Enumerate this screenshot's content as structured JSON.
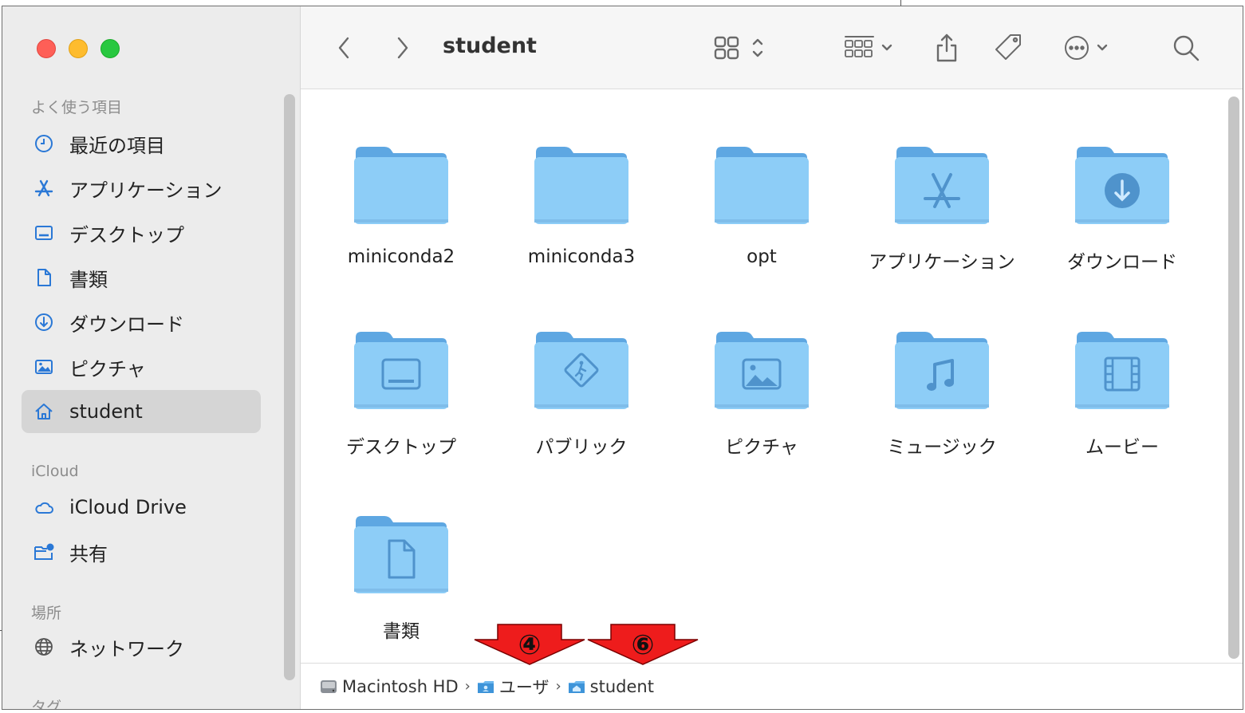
{
  "window": {
    "title": "student"
  },
  "toolbar": {
    "back_icon": "chevron-left-icon",
    "forward_icon": "chevron-right-icon",
    "title": "student",
    "view_icon": "icon-grid-view-icon",
    "group_icon": "group-view-icon",
    "share_icon": "share-icon",
    "tag_icon": "tag-icon",
    "more_icon": "ellipsis-circle-icon",
    "search_icon": "search-icon"
  },
  "sidebar": {
    "sections": {
      "favorites": "よく使う項目",
      "icloud": "iCloud",
      "locations": "場所",
      "tags": "タグ"
    },
    "favorites": [
      {
        "label": "最近の項目",
        "icon": "clock-icon"
      },
      {
        "label": "アプリケーション",
        "icon": "applications-icon"
      },
      {
        "label": "デスクトップ",
        "icon": "desktop-icon"
      },
      {
        "label": "書類",
        "icon": "document-icon"
      },
      {
        "label": "ダウンロード",
        "icon": "download-icon"
      },
      {
        "label": "ピクチャ",
        "icon": "photo-icon"
      },
      {
        "label": "student",
        "icon": "home-icon",
        "selected": true
      }
    ],
    "icloud": [
      {
        "label": "iCloud Drive",
        "icon": "cloud-icon"
      },
      {
        "label": "共有",
        "icon": "shared-folder-icon"
      }
    ],
    "locations": [
      {
        "label": "ネットワーク",
        "icon": "network-icon"
      }
    ]
  },
  "files": [
    {
      "label": "miniconda2",
      "glyph": "none"
    },
    {
      "label": "miniconda3",
      "glyph": "none"
    },
    {
      "label": "opt",
      "glyph": "none"
    },
    {
      "label": "アプリケーション",
      "glyph": "app"
    },
    {
      "label": "ダウンロード",
      "glyph": "download"
    },
    {
      "label": "デスクトップ",
      "glyph": "desktop"
    },
    {
      "label": "パブリック",
      "glyph": "public"
    },
    {
      "label": "ピクチャ",
      "glyph": "picture"
    },
    {
      "label": "ミュージック",
      "glyph": "music"
    },
    {
      "label": "ムービー",
      "glyph": "movie"
    },
    {
      "label": "書類",
      "glyph": "document"
    }
  ],
  "pathbar": {
    "items": [
      {
        "label": "Macintosh HD",
        "icon": "hard-drive-icon"
      },
      {
        "label": "ユーザ",
        "icon": "users-folder-icon"
      },
      {
        "label": "student",
        "icon": "home-folder-icon"
      }
    ],
    "separator": "›"
  },
  "annotations": [
    {
      "label": "④",
      "color": "#ee1c1c"
    },
    {
      "label": "⑥",
      "color": "#ee1c1c"
    }
  ],
  "colors": {
    "folder_body": "#8dcdf7",
    "folder_tab": "#5ea7e2",
    "folder_glyph": "#4f93cc",
    "selected_bg": "#d5d5d5",
    "annotation_red": "#ee1c1c"
  }
}
